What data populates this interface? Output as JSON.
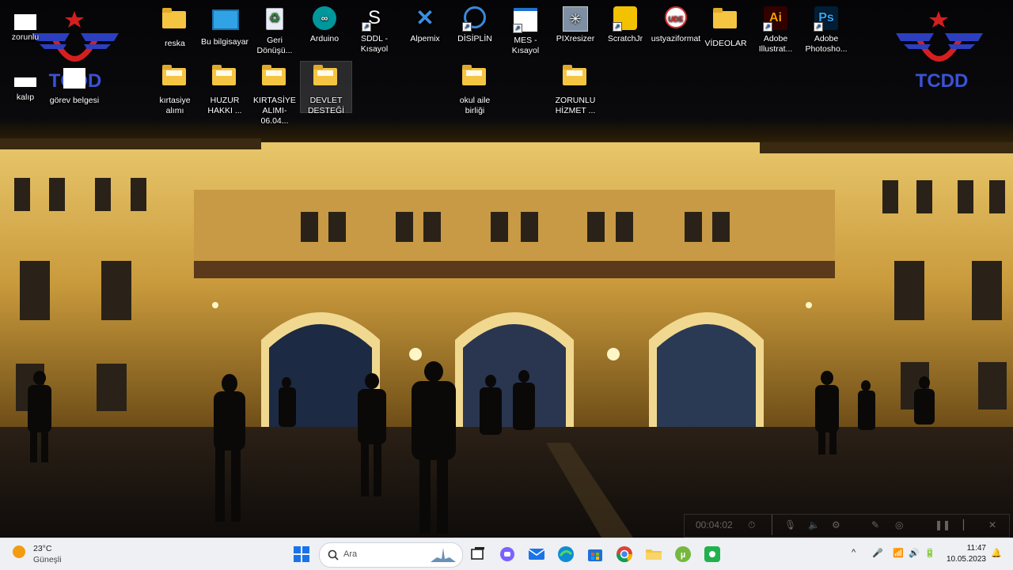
{
  "desktop": {
    "icons": [
      {
        "label": "zorunlu"
      },
      {
        "label": "kalıp"
      },
      {
        "label": "görev belgesi"
      },
      {
        "label": "reska"
      },
      {
        "label": "Bu bilgisayar"
      },
      {
        "label": "Geri Dönüşü..."
      },
      {
        "label": "Arduino"
      },
      {
        "label": "SDDL - Kısayol"
      },
      {
        "label": "Alpemix"
      },
      {
        "label": "DİSİPLİN"
      },
      {
        "label": "MES - Kısayol"
      },
      {
        "label": "PIXresizer"
      },
      {
        "label": "ScratchJr"
      },
      {
        "label": "ustyaziformat"
      },
      {
        "label": "VİDEOLAR"
      },
      {
        "label": "Adobe Illustrat..."
      },
      {
        "label": "Adobe Photosho..."
      },
      {
        "label": "kırtasiye alımı"
      },
      {
        "label": "HUZUR HAKKI ..."
      },
      {
        "label": "KIRTASİYE ALIMI-06.04..."
      },
      {
        "label": "DEVLET DESTEĞİ"
      },
      {
        "label": "okul aile birliği"
      },
      {
        "label": "ZORUNLU HİZMET ..."
      }
    ],
    "logo_text": "TCDD",
    "logo_colors": {
      "star": "#d51f1f",
      "ring": "#d51f1f",
      "wing": "#2b3fbf",
      "text": "#3a52d6"
    }
  },
  "recorder": {
    "time": "00:04:02"
  },
  "taskbar": {
    "weather": {
      "temp": "23°C",
      "condition": "Güneşli"
    },
    "search": {
      "placeholder": "Ara"
    },
    "clock": {
      "time": "11:47",
      "date": "10.05.2023"
    },
    "tray_caret": "^"
  }
}
